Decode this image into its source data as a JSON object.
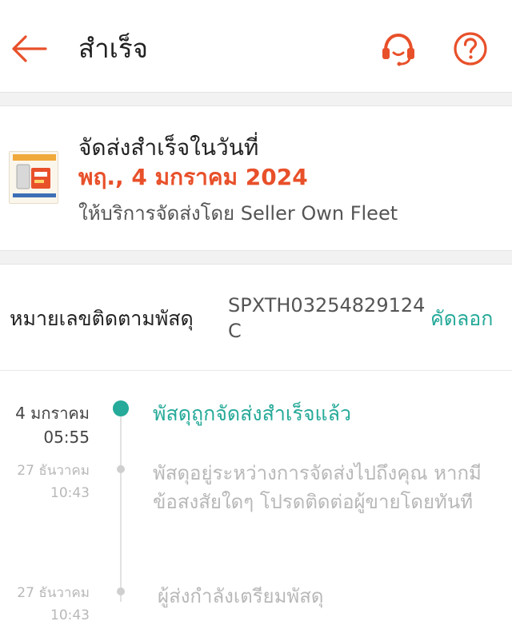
{
  "header": {
    "title": "สำเร็จ",
    "back_icon": "arrow-left-icon",
    "support_icon": "headset-icon",
    "help_icon": "question-circle-icon"
  },
  "delivery": {
    "label": "จัดส่งสำเร็จในวันที่",
    "date": "พฤ., 4 มกราคม 2024",
    "carrier_text": "ให้บริการจัดส่งโดย Seller Own Fleet"
  },
  "tracking": {
    "label": "หมายเลขติดตามพัสดุ",
    "number": "SPXTH03254829124C",
    "copy_label": "คัดลอก"
  },
  "timeline": [
    {
      "date": "4 มกราคม",
      "time": "05:55",
      "text": "พัสดุถูกจัดส่งสำเร็จแล้ว",
      "active": true
    },
    {
      "date": "27 ธันวาคม",
      "time": "10:43",
      "text": "พัสดุอยู่ระหว่างการจัดส่งไปถึงคุณ หากมีข้อสงสัยใดๆ โปรดติดต่อผู้ขายโดยทันที",
      "active": false
    },
    {
      "date": "27 ธันวาคม",
      "time": "10:43",
      "text": "ผู้ส่งกำลังเตรียมพัสดุ",
      "active": false
    }
  ],
  "colors": {
    "accent": "#e8502a",
    "success": "#26aa99"
  }
}
